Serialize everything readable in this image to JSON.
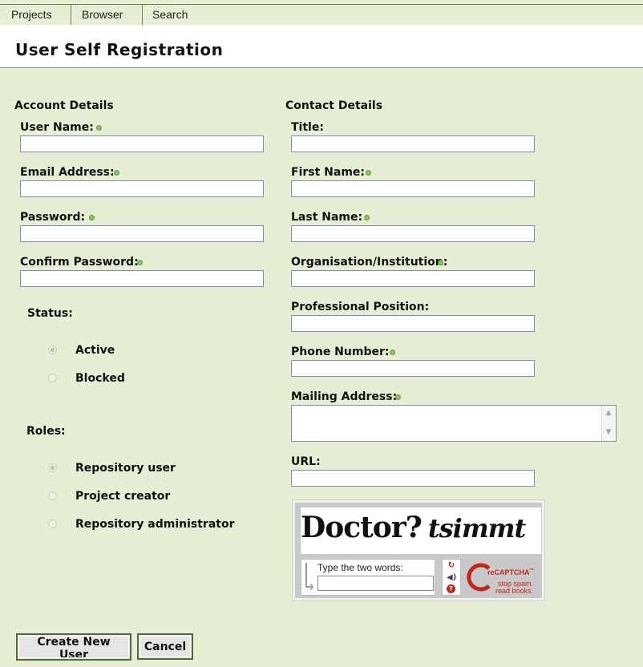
{
  "nav": {
    "tabs": [
      "Projects",
      "Browser",
      "Search"
    ]
  },
  "header": {
    "title": "User Self Registration"
  },
  "account": {
    "section_title": "Account Details",
    "fields": {
      "user_name": {
        "label": "User Name:",
        "value": ""
      },
      "email": {
        "label": "Email Address:",
        "value": ""
      },
      "password": {
        "label": "Password:",
        "value": ""
      },
      "confirm_password": {
        "label": "Confirm Password:",
        "value": ""
      }
    },
    "status": {
      "label": "Status:",
      "options": [
        "Active",
        "Blocked"
      ],
      "selected": "Active"
    },
    "roles": {
      "label": "Roles:",
      "options": [
        "Repository user",
        "Project creator",
        "Repository administrator"
      ],
      "selected": "Repository user"
    }
  },
  "contact": {
    "section_title": "Contact Details",
    "fields": {
      "title": {
        "label": "Title:",
        "value": ""
      },
      "first_name": {
        "label": "First Name:",
        "value": ""
      },
      "last_name": {
        "label": "Last Name:",
        "value": ""
      },
      "organisation": {
        "label": "Organisation/Institution:",
        "value": ""
      },
      "position": {
        "label": "Professional Position:",
        "value": ""
      },
      "phone": {
        "label": "Phone Number:",
        "value": ""
      },
      "mailing_address": {
        "label": "Mailing Address:",
        "value": ""
      },
      "url": {
        "label": "URL:",
        "value": ""
      }
    }
  },
  "captcha": {
    "words": [
      "Doctor?",
      "tsimmt"
    ],
    "prompt": "Type the two words:",
    "brand_prefix": "re",
    "brand": "CAPTCHA",
    "trademark": "™",
    "slogan_line1": "stop spam.",
    "slogan_line2": "read books.",
    "icons": [
      "refresh-icon",
      "audio-icon",
      "help-icon"
    ]
  },
  "actions": {
    "create_label": "Create New User",
    "cancel_label": "Cancel"
  },
  "colors": {
    "page_bg": "#e6efd3",
    "required_dot": "#8ec36e",
    "button_border": "#4f6b3c",
    "recaptcha_red": "#c0281b"
  }
}
